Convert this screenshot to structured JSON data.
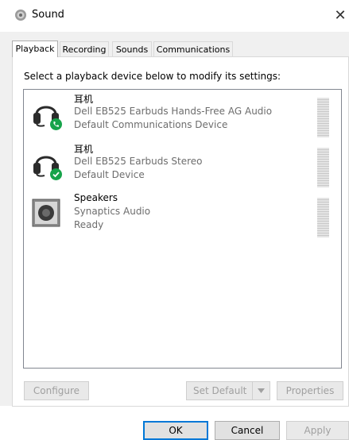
{
  "window": {
    "title": "Sound",
    "close_glyph": "✕"
  },
  "tabs": [
    {
      "label": "Playback",
      "active": true
    },
    {
      "label": "Recording",
      "active": false
    },
    {
      "label": "Sounds",
      "active": false
    },
    {
      "label": "Communications",
      "active": false
    }
  ],
  "instruction": "Select a playback device below to modify its settings:",
  "devices": [
    {
      "name": "耳机",
      "description": "Dell EB525 Earbuds Hands-Free AG Audio",
      "status": "Default Communications Device",
      "icon": "headset-icon",
      "badge": "phone-badge-icon"
    },
    {
      "name": "耳机",
      "description": "Dell EB525 Earbuds Stereo",
      "status": "Default Device",
      "icon": "headset-icon",
      "badge": "checkmark-badge-icon"
    },
    {
      "name": "Speakers",
      "description": "Synaptics Audio",
      "status": "Ready",
      "icon": "speaker-icon",
      "badge": ""
    }
  ],
  "buttons": {
    "configure": "Configure",
    "set_default": "Set Default",
    "properties": "Properties",
    "ok": "OK",
    "cancel": "Cancel",
    "apply": "Apply"
  },
  "colors": {
    "accent": "#0078d7",
    "badge_green": "#16a34a",
    "list_border": "#828790"
  }
}
